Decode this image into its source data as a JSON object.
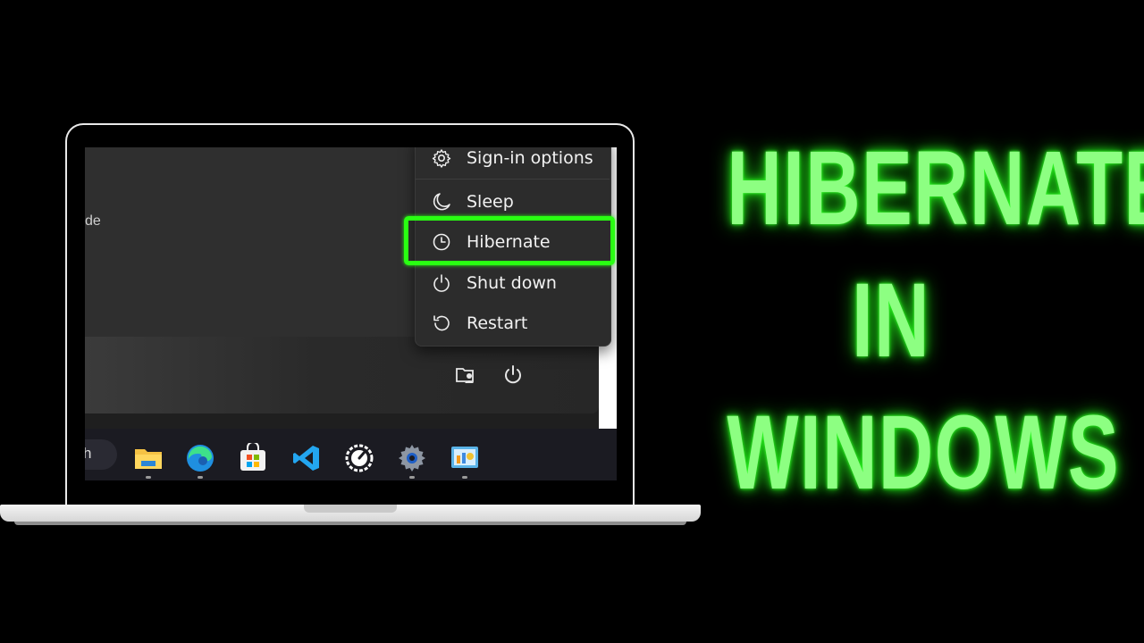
{
  "power_menu": {
    "items": [
      {
        "label": "Sign-in options",
        "icon": "gear-icon"
      },
      {
        "label": "Sleep",
        "icon": "moon-icon"
      },
      {
        "label": "Hibernate",
        "icon": "clock-icon"
      },
      {
        "label": "Shut down",
        "icon": "power-icon"
      },
      {
        "label": "Restart",
        "icon": "restart-icon"
      }
    ],
    "highlighted": "Hibernate",
    "highlight_color": "#29ff12"
  },
  "start_menu": {
    "partial_text": "de",
    "bottom_icons": [
      "user-folder-icon",
      "power-icon"
    ]
  },
  "taskbar": {
    "search_partial": "h",
    "apps": [
      "file-explorer-icon",
      "edge-icon",
      "store-icon",
      "vscode-icon",
      "speedtest-icon",
      "settings-icon",
      "control-panel-icon"
    ]
  },
  "title": {
    "lines": [
      "HIBERNATE",
      "IN",
      "WINDOWS"
    ],
    "color": "#8dff82"
  }
}
